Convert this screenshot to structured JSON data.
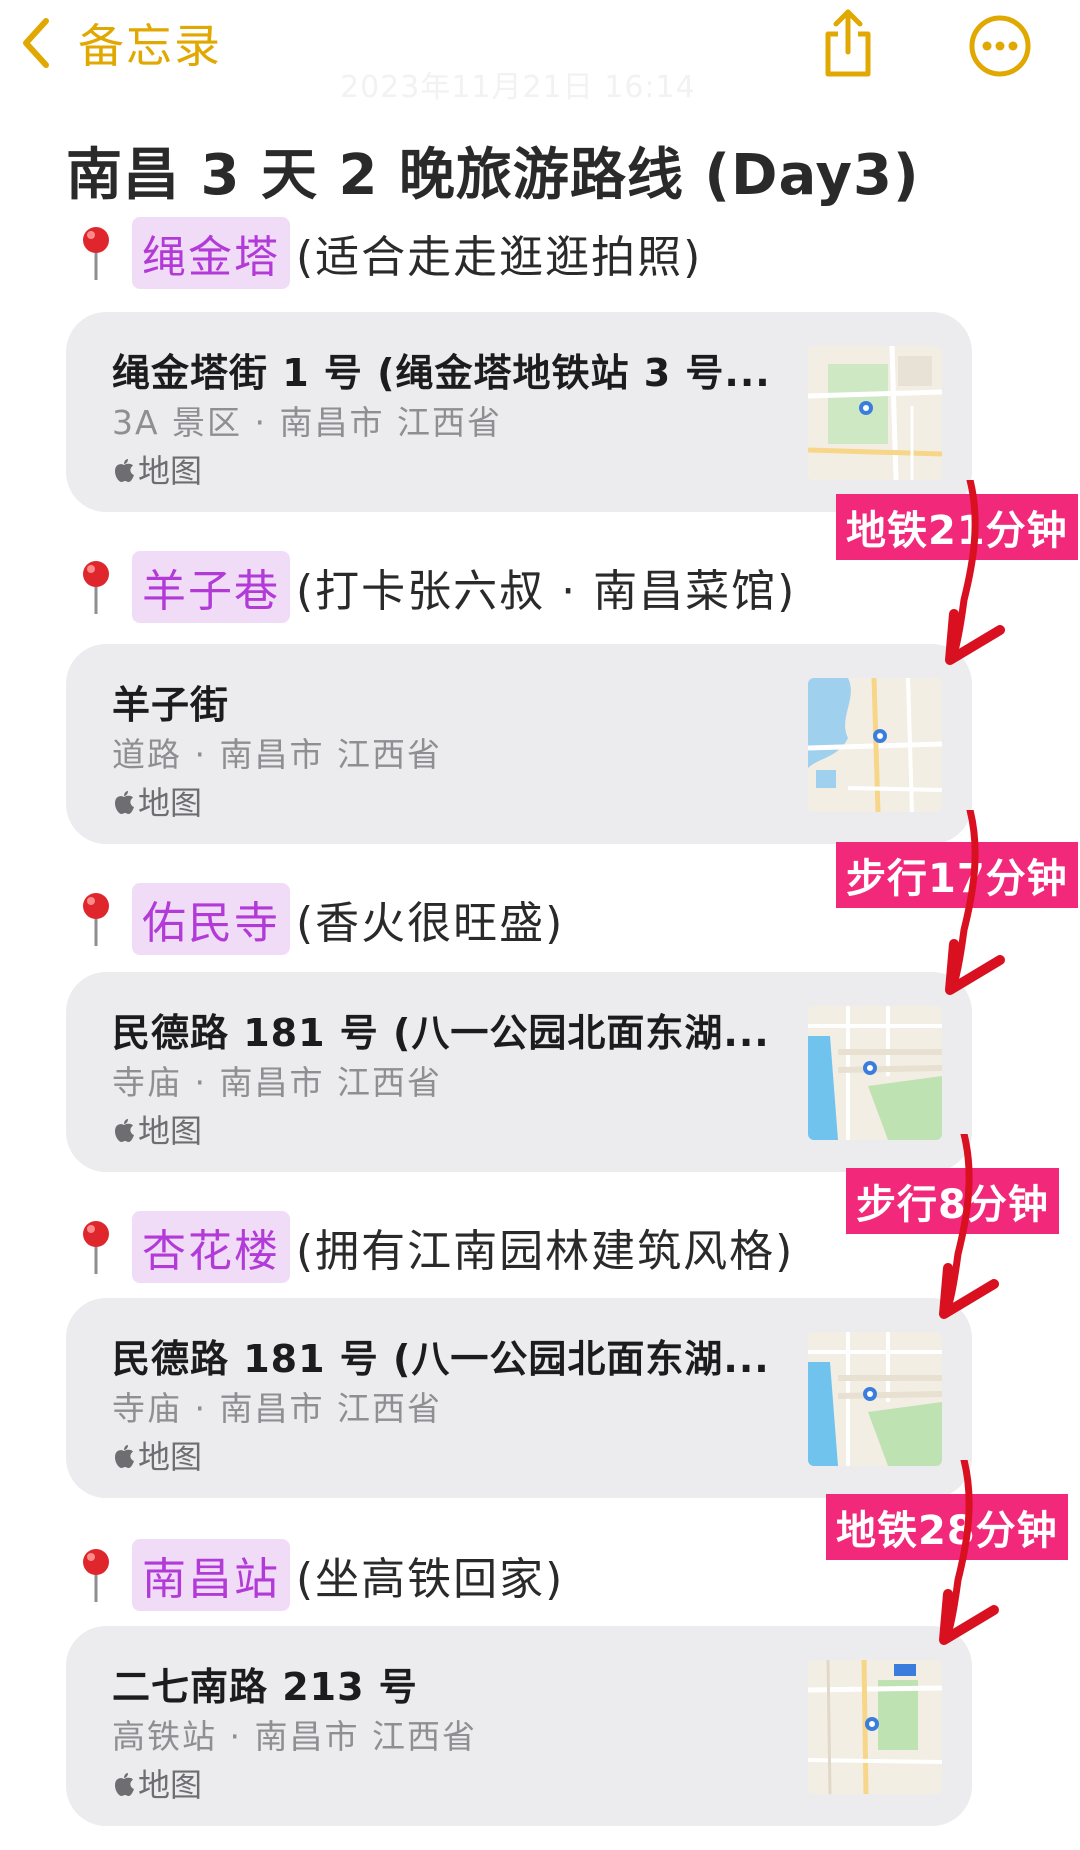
{
  "nav": {
    "back_label": "备忘录",
    "date_line": "2023年11月21日 16:14"
  },
  "title": "南昌 3 天 2 晚旅游路线 (Day3)",
  "stops": [
    {
      "name": "绳金塔",
      "note": "(适合走走逛逛拍照)",
      "address": "绳金塔街 1 号 (绳金塔地铁站 3 号...",
      "type": "3A 景区 · 南昌市 江西省",
      "source": "地图"
    },
    {
      "name": "羊子巷",
      "note": "(打卡张六叔 · 南昌菜馆)",
      "address": "羊子街",
      "type": "道路 · 南昌市 江西省",
      "source": "地图"
    },
    {
      "name": "佑民寺",
      "note": "(香火很旺盛)",
      "address": "民德路 181 号 (八一公园北面东湖...",
      "type": "寺庙 · 南昌市 江西省",
      "source": "地图"
    },
    {
      "name": "杏花楼",
      "note": "(拥有江南园林建筑风格)",
      "address": "民德路 181 号 (八一公园北面东湖...",
      "type": "寺庙 · 南昌市 江西省",
      "source": "地图"
    },
    {
      "name": "南昌站",
      "note": "(坐高铁回家)",
      "address": "二七南路 213 号",
      "type": "高铁站 · 南昌市 江西省",
      "source": "地图"
    }
  ],
  "transit": [
    {
      "label": "地铁21分钟"
    },
    {
      "label": "步行17分钟"
    },
    {
      "label": "步行8分钟"
    },
    {
      "label": "地铁28分钟"
    }
  ],
  "colors": {
    "accent": "#e0a800",
    "tag_text": "#b23bd8",
    "tag_bg": "#f1dcf7",
    "transit_bg": "#f2297a",
    "arrow": "#d8101f",
    "card_bg": "#ececef"
  }
}
